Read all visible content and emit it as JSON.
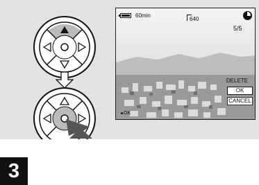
{
  "screen": {
    "battery_time": "60min",
    "image_size": "640",
    "image_counter": "5/5",
    "menu": {
      "title": "DELETE",
      "options": [
        "OK",
        "CANCEL"
      ],
      "selected": "OK"
    },
    "hint": "OK",
    "battery_icon": "battery-icon",
    "remaining_icon": "pie-remaining-icon"
  },
  "controls": {
    "top_dpad": {
      "pressed": "up"
    },
    "bottom_dpad": {
      "pressed": "center"
    },
    "arrow_icon": "arrow-down-icon",
    "pointer_icon": "pressing-finger-arrow-icon"
  },
  "step_number": "3",
  "colors": {
    "panel": "#e2e2e2",
    "pressed": "#bbbbbb",
    "step_bg": "#111111"
  }
}
